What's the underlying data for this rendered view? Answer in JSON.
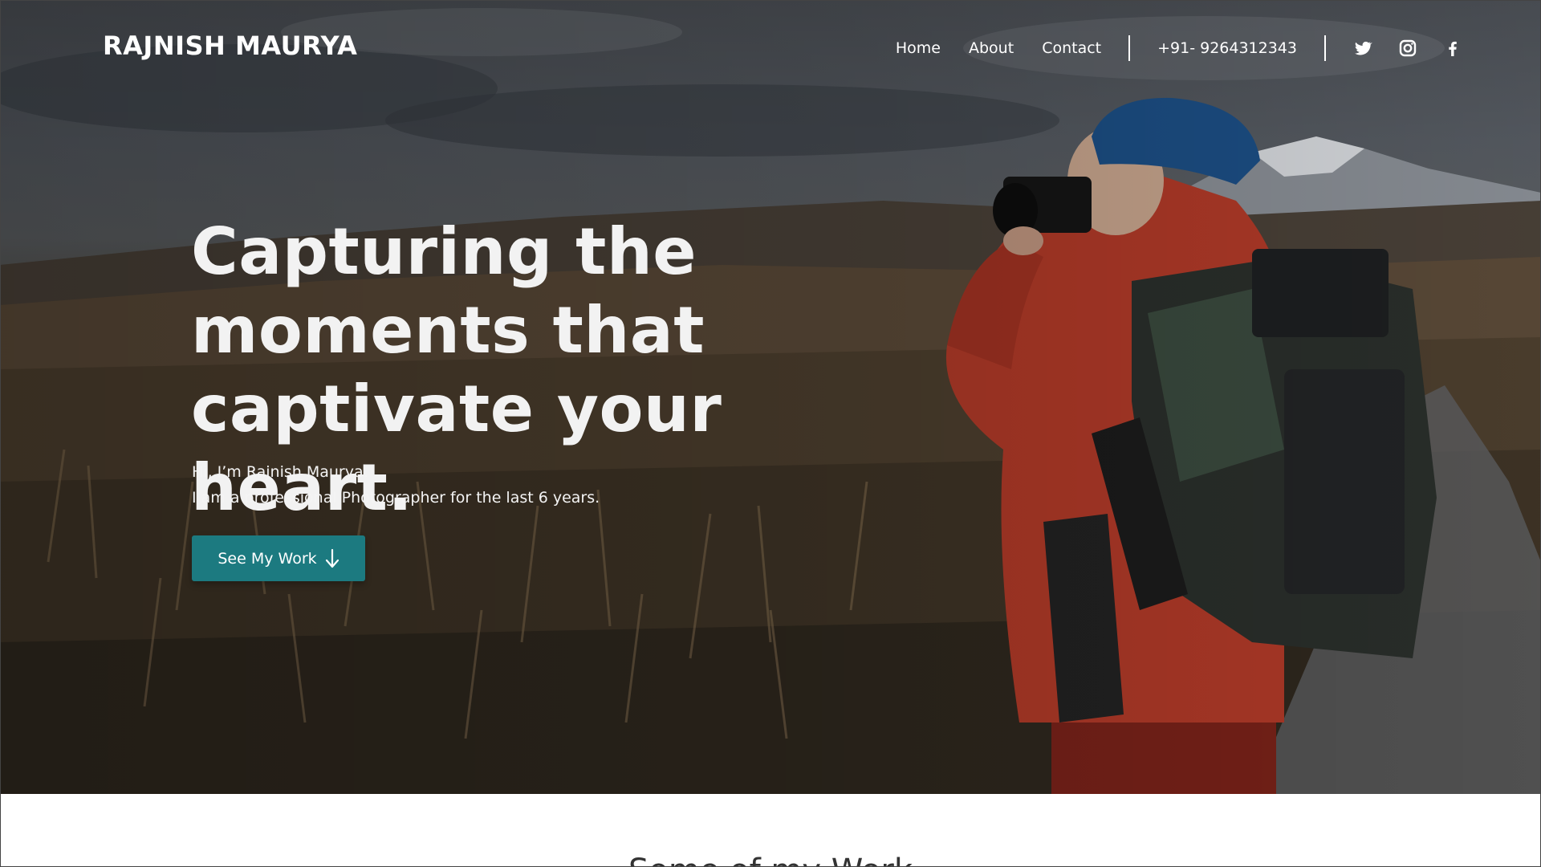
{
  "brand": {
    "name": "RAJNISH MAURYA"
  },
  "nav": {
    "links": [
      "Home",
      "About",
      "Contact"
    ],
    "phone": "+91- 9264312343",
    "social_icons": [
      "twitter-icon",
      "instagram-icon",
      "facebook-icon"
    ]
  },
  "hero": {
    "headline": "Capturing the moments that captivate your heart.",
    "intro_line1": "Hi, I’m Rajnish Maurya.",
    "intro_line2": "I am a professional Photographer for the last 6 years.",
    "cta_label": "See My Work",
    "cta_icon": "arrow-down-icon",
    "image": "photographer-with-camera-landscape"
  },
  "section": {
    "title": "Some of my Work"
  },
  "colors": {
    "accent": "#1c7a80",
    "text_light": "#ffffff",
    "page_bg": "#ffffff"
  }
}
